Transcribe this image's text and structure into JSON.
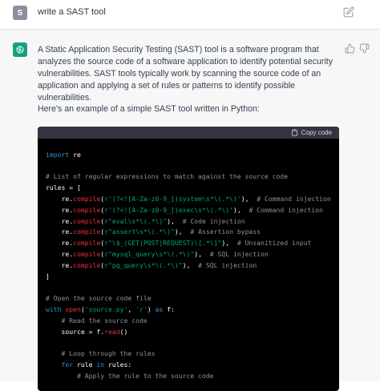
{
  "user": {
    "avatar_letter": "S",
    "message": "write  a SAST tool",
    "edit_icon": "edit-icon"
  },
  "assistant": {
    "avatar_icon": "openai-logo-icon",
    "paragraph1": "A Static Application Security Testing (SAST) tool is a software program that analyzes the source code of a software application to identify potential security vulnerabilities. SAST tools typically work by scanning the source code of an application and applying a set of rules or patterns to identify possible vulnerabilities.",
    "paragraph2": "Here's an example of a simple SAST tool written in Python:",
    "feedback_icons": [
      "thumbs-up-icon",
      "thumbs-down-icon"
    ]
  },
  "code_block": {
    "copy_label": "Copy code",
    "copy_icon": "clipboard-icon",
    "language": "python",
    "lines": [
      "",
      "import re",
      "",
      "# List of regular expressions to match against the source code",
      "rules = [",
      "    re.compile(r'(?<![A-Za-z0-9_])system\\s*\\(.*\\)'),  # Command injection",
      "    re.compile(r'(?<![A-Za-z0-9_])exec\\s*\\(.*\\)'),  # Command injection",
      "    re.compile(r\"eval\\s*\\(.*\\)\"),  # Code injection",
      "    re.compile(r\"assert\\s*\\(.*\\)\"),  # Assertion bypass",
      "    re.compile(r\"\\$_(GET|POST|REQUEST)\\[.*\\]\"),  # Unsanitized input",
      "    re.compile(r\"mysql_query\\s*\\(.*\\)\"),  # SQL injection",
      "    re.compile(r\"pg_query\\s*\\(.*\\)\"),  # SQL injection",
      "]",
      "",
      "# Open the source code file",
      "with open('source.py', 'r') as f:",
      "    # Read the source code",
      "    source = f.read()",
      "",
      "    # Loop through the rules",
      "    for rule in rules:",
      "        # Apply the rule to the source code"
    ]
  },
  "colors": {
    "keyword": "#2e95d3",
    "function": "#f22c3d",
    "string": "#00a67d",
    "comment": "#8f8f9c",
    "code_background": "#000000",
    "code_header": "#343541",
    "brand": "#10a37f"
  }
}
